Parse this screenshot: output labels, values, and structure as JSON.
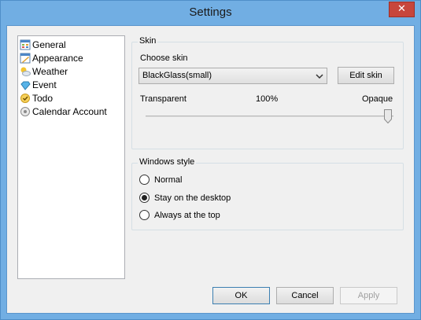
{
  "window": {
    "title": "Settings",
    "close_glyph": "✕"
  },
  "sidebar": {
    "items": [
      {
        "label": "General",
        "icon": "general-icon"
      },
      {
        "label": "Appearance",
        "icon": "appearance-icon"
      },
      {
        "label": "Weather",
        "icon": "weather-icon"
      },
      {
        "label": "Event",
        "icon": "event-icon"
      },
      {
        "label": "Todo",
        "icon": "todo-icon"
      },
      {
        "label": "Calendar Account",
        "icon": "calendar-account-icon"
      }
    ]
  },
  "skin": {
    "group_label": "Skin",
    "choose_label": "Choose skin",
    "selected_skin": "BlackGlass(small)",
    "edit_button": "Edit skin",
    "transparent_label": "Transparent",
    "opacity_value": "100%",
    "opaque_label": "Opaque",
    "opacity_fraction": 1.0
  },
  "windows_style": {
    "group_label": "Windows style",
    "options": [
      {
        "label": "Normal",
        "checked": false
      },
      {
        "label": "Stay on the desktop",
        "checked": true
      },
      {
        "label": "Always at the top",
        "checked": false
      }
    ]
  },
  "footer": {
    "ok": "OK",
    "cancel": "Cancel",
    "apply": "Apply"
  },
  "colors": {
    "title_bar": "#71aee3",
    "close_button": "#c7463c",
    "dialog_bg": "#f0f0f0"
  }
}
